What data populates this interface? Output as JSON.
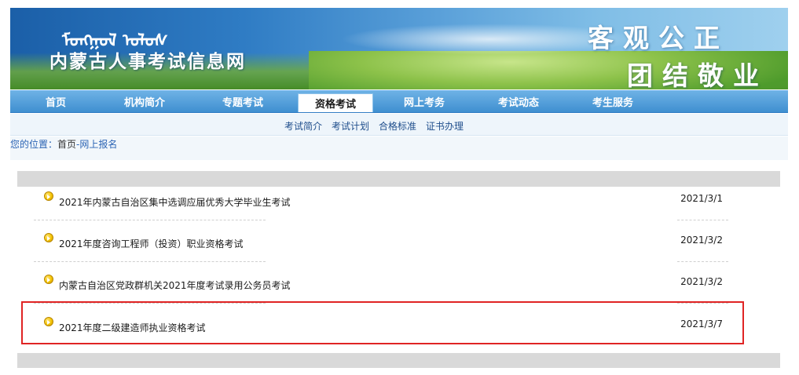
{
  "header": {
    "mongolian_script": "ᠮᠣᠩᠭᠣᠯ ᠤᠯᠤᠰ",
    "site_title": "内蒙古人事考试信息网",
    "slogan_line1": "客观公正",
    "slogan_line2": "团结敬业"
  },
  "nav": {
    "items": [
      {
        "label": "首页"
      },
      {
        "label": "机构简介"
      },
      {
        "label": "专题考试"
      },
      {
        "label": "资格考试",
        "active": true
      },
      {
        "label": "网上考务"
      },
      {
        "label": "考试动态"
      },
      {
        "label": "考生服务"
      }
    ]
  },
  "subnav": {
    "items": [
      {
        "label": "考试简介"
      },
      {
        "label": "考试计划"
      },
      {
        "label": "合格标准"
      },
      {
        "label": "证书办理"
      }
    ]
  },
  "breadcrumb": {
    "label": "您的位置：",
    "home": "首页",
    "current": "-网上报名"
  },
  "list": {
    "items": [
      {
        "title": "2021年内蒙古自治区集中选调应届优秀大学毕业生考试",
        "date": "2021/3/1"
      },
      {
        "title": "2021年度咨询工程师（投资）职业资格考试",
        "date": "2021/3/2"
      },
      {
        "title": "内蒙古自治区党政群机关2021年度考试录用公务员考试",
        "date": "2021/3/2"
      },
      {
        "title": "2021年度二级建造师执业资格考试",
        "date": "2021/3/7"
      }
    ]
  },
  "colors": {
    "nav_blue": "#3f8fd0",
    "highlight_red": "#e02424",
    "link_blue": "#2b64b4"
  }
}
